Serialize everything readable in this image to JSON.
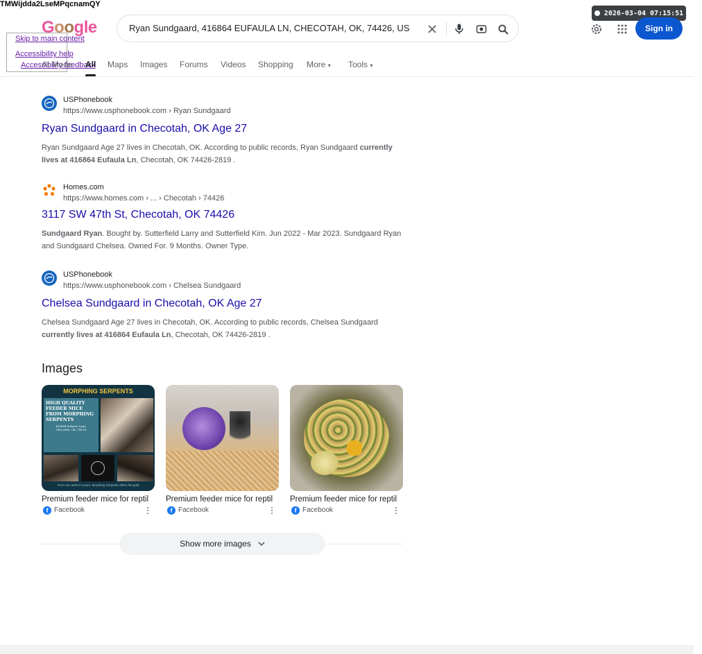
{
  "overlay": {
    "garbled_text": "TMWijdda2LseMPqcnamQY",
    "skip_main": "Skip to main content",
    "accessibility_help": "Accessibility help",
    "accessibility_feedback": "Accessibility feedback",
    "timestamp": "2026-03-04 07:15:51"
  },
  "header": {
    "logo": [
      "G",
      "o",
      "o",
      "g",
      "l",
      "e"
    ],
    "query": "Ryan Sundgaard, 416864 EUFAULA LN, CHECOTAH, OK, 74426, US",
    "signin": "Sign in"
  },
  "tabs": [
    "AI Mode",
    "All",
    "Maps",
    "Images",
    "Forums",
    "Videos",
    "Shopping",
    "More",
    "Tools"
  ],
  "results": [
    {
      "source": "USPhonebook",
      "url": "https://www.usphonebook.com › Ryan Sundgaard",
      "title": "Ryan Sundgaard in Checotah, OK Age 27",
      "snippet_plain": "Ryan Sundgaard Age 27 lives in Checotah, OK. According to public records, Ryan Sundgaard ",
      "snippet_bold": "currently lives at 416864 Eufaula Ln",
      "snippet_tail": ", Checotah, OK 74426-2819 ."
    },
    {
      "source": "Homes.com",
      "url": "https://www.homes.com › ... › Checotah › 74426",
      "title": "3117 SW 47th St, Checotah, OK 74426",
      "snippet_bold": "Sundgaard Ryan",
      "snippet_plain": ". Bought by. Sutterfield Larry and Sutterfield Kim. Jun 2022 - Mar 2023. Sundgaard Ryan and Sundgaard Chelsea. Owned For. 9 Months. Owner Type."
    },
    {
      "source": "USPhonebook",
      "url": "https://www.usphonebook.com › Chelsea Sundgaard",
      "title": "Chelsea Sundgaard in Checotah, OK Age 27",
      "snippet_plain": "Chelsea Sundgaard Age 27 lives in Checotah, OK. According to public records, Chelsea Sundgaard ",
      "snippet_bold": "currently lives at 416864 Eufaula Ln",
      "snippet_tail": ", Checotah, OK 74426-2819 ."
    }
  ],
  "images": {
    "heading": "Images",
    "cards": [
      {
        "caption": "Premium feeder mice for reptil",
        "source": "Facebook",
        "banner": "MORPHING SERPENTS",
        "overlay_text": "HIGH QUALITY FEEDER MICE FROM MORPHING SERPENTS",
        "overlay_sub": "416864 Eufaula Lane, Checotah, OK, 74126",
        "footer_text": "From our racks to yours, Morphing Serpents offers the gold"
      },
      {
        "caption": "Premium feeder mice for reptil",
        "source": "Facebook"
      },
      {
        "caption": "Premium feeder mice for reptil",
        "source": "Facebook"
      }
    ],
    "show_more": "Show more images"
  },
  "colors": {
    "link": "#1a0dab",
    "signin": "#0b57d0",
    "logo": "#e8579c"
  }
}
